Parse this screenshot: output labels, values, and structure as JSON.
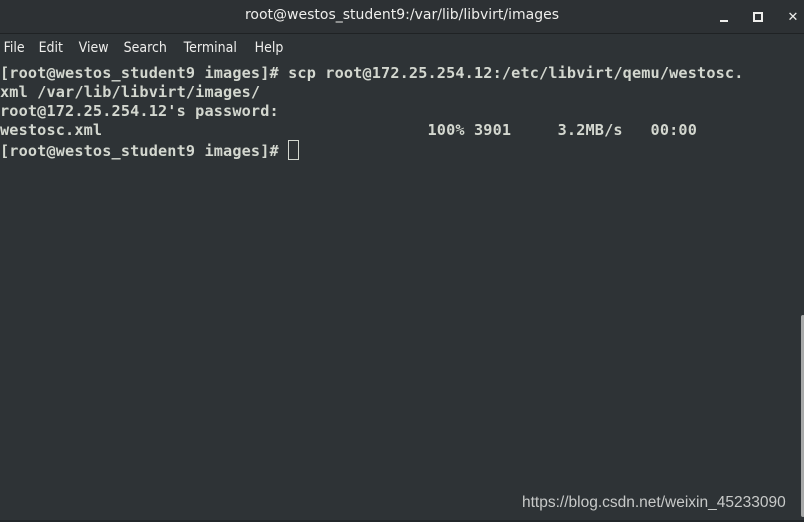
{
  "window": {
    "title": "root@westos_student9:/var/lib/libvirt/images",
    "controls": {
      "minimize": "minimize-icon",
      "maximize": "maximize-icon",
      "close": "close-icon"
    }
  },
  "menubar": {
    "items": [
      "File",
      "Edit",
      "View",
      "Search",
      "Terminal",
      "Help"
    ]
  },
  "terminal": {
    "lines": [
      "[root@westos_student9 images]# scp root@172.25.254.12:/etc/libvirt/qemu/westosc.",
      "xml /var/lib/libvirt/images/",
      "root@172.25.254.12's password:",
      "westosc.xml                                   100% 3901     3.2MB/s   00:00",
      "[root@westos_student9 images]# "
    ]
  },
  "watermark": "https://blog.csdn.net/weixin_45233090"
}
